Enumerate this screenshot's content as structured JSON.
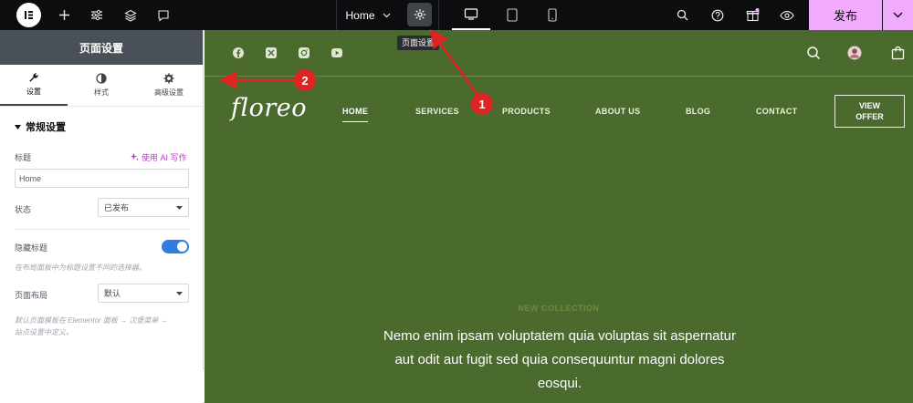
{
  "topbar": {
    "doc_name": "Home",
    "tooltip": "页面设置",
    "publish_label": "发布",
    "colors": {
      "bar": "#0c0d0e",
      "publish": "#f0abfc"
    }
  },
  "panel": {
    "title": "页面设置",
    "tabs": [
      {
        "label": "设置",
        "icon": "wrench-icon"
      },
      {
        "label": "样式",
        "icon": "half-circle-icon"
      },
      {
        "label": "高级设置",
        "icon": "gear-icon"
      }
    ],
    "section_title": "常规设置",
    "title_label": "标题",
    "ai_label": "使用 AI 写作",
    "title_value": "Home",
    "status_label": "状态",
    "status_value": "已发布",
    "hide_title_label": "隐藏标题",
    "hide_title_enabled": true,
    "hide_title_hint": "在布局面板中为标题设置不同的选择器。",
    "page_layout_label": "页面布局",
    "page_layout_value": "默认",
    "layout_hint_line1": "默认页面模板在 Elementor 面板 → 汉堡菜单 →",
    "layout_hint_line2": "站点设置中定义。"
  },
  "site": {
    "brand": "floreo",
    "nav": [
      "HOME",
      "SERVICES",
      "PRODUCTS",
      "ABOUT US",
      "BLOG",
      "CONTACT"
    ],
    "cta_line1": "VIEW",
    "cta_line2": "OFFER",
    "eyebrow": "NEW COLLECTION",
    "hero_line1": "Nemo enim ipsam voluptatem quia voluptas sit aspernatur",
    "hero_line2": "aut odit aut fugit sed quia consequuntur magni dolores",
    "hero_line3": "eosqui.",
    "colors": {
      "background": "#4b6a2e"
    }
  },
  "annotations": {
    "marker1": "1",
    "marker2": "2",
    "color": "#e02424"
  }
}
